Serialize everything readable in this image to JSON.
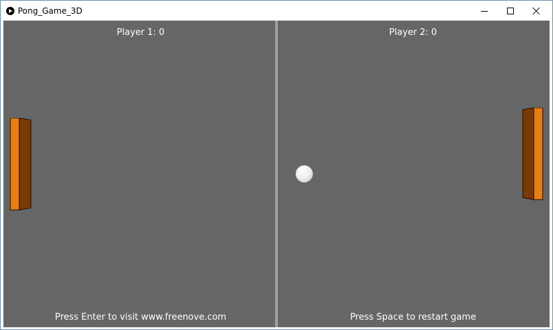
{
  "window": {
    "title": "Pong_Game_3D",
    "controls": {
      "minimize": "minimize-icon",
      "maximize": "maximize-icon",
      "close": "close-icon"
    }
  },
  "game": {
    "player1_score_text": "Player 1: 0",
    "player2_score_text": "Player 2: 0",
    "left_hint": "Press Enter to visit www.freenove.com",
    "right_hint": "Press Space to restart game"
  },
  "colors": {
    "court": "#666666",
    "divider": "#a0a0a0",
    "paddle_face": "#e87d14",
    "paddle_side": "#7a3a06",
    "ball": "#f0f0f0",
    "text": "#ffffff"
  }
}
